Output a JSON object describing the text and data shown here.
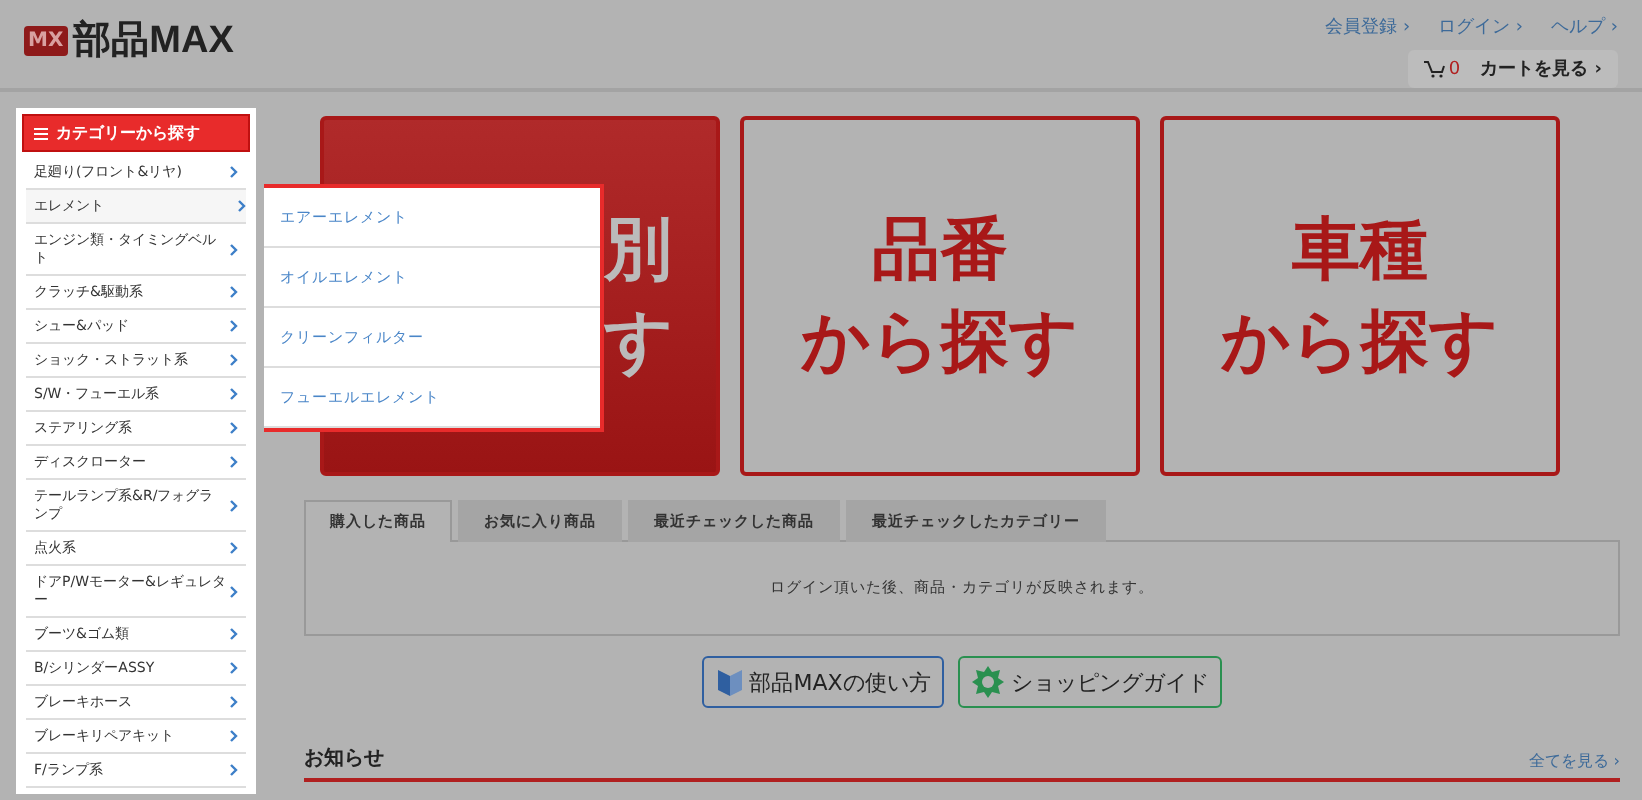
{
  "header": {
    "logo_mark": "MX",
    "logo_text": "部品MAX",
    "links": [
      "会員登録 ›",
      "ログイン ›",
      "ヘルプ ›"
    ],
    "cart_count": "0",
    "cart_button": "カートを見る ›"
  },
  "sidebar": {
    "title": "カテゴリーから探す",
    "items": [
      {
        "label": "足廻り(フロント&リヤ)",
        "selected": false
      },
      {
        "label": "エレメント",
        "selected": true,
        "children": [
          {
            "label": "エアーエレメント"
          },
          {
            "label": "オイルエレメント"
          },
          {
            "label": "クリーンフィルター"
          },
          {
            "label": "フューエルエレメント"
          }
        ]
      },
      {
        "label": "エンジン類・タイミングベルト",
        "selected": false
      },
      {
        "label": "クラッチ&駆動系",
        "selected": false
      },
      {
        "label": "シュー&パッド",
        "selected": false
      },
      {
        "label": "ショック・ストラット系",
        "selected": false
      },
      {
        "label": "S/W・フューエル系",
        "selected": false
      },
      {
        "label": "ステアリング系",
        "selected": false
      },
      {
        "label": "ディスクローター",
        "selected": false
      },
      {
        "label": "テールランプ系&R/フォグランプ",
        "selected": false
      },
      {
        "label": "点火系",
        "selected": false
      },
      {
        "label": "ドアP/Wモーター&レギュレター",
        "selected": false
      },
      {
        "label": "ブーツ&ゴム類",
        "selected": false
      },
      {
        "label": "B/シリンダーASSY",
        "selected": false
      },
      {
        "label": "ブレーキホース",
        "selected": false
      },
      {
        "label": "ブレーキリペアキット",
        "selected": false
      },
      {
        "label": "F/ランプ系",
        "selected": false
      }
    ]
  },
  "search_cards": [
    {
      "kind": "filled",
      "lines": [
        "別",
        "す"
      ]
    },
    {
      "kind": "outline",
      "lines": [
        "品番",
        "から探す"
      ]
    },
    {
      "kind": "outline",
      "lines": [
        "車種",
        "から探す"
      ]
    }
  ],
  "history_tabs": [
    {
      "label": "購入した商品",
      "selected": true
    },
    {
      "label": "お気に入り商品",
      "selected": false
    },
    {
      "label": "最近チェックした商品",
      "selected": false
    },
    {
      "label": "最近チェックしたカテゴリー",
      "selected": false
    }
  ],
  "history_message": "ログイン頂いた後、商品・カテゴリが反映されます。",
  "guide_buttons": [
    {
      "kind": "howto",
      "label": "部品MAXの使い方"
    },
    {
      "kind": "shopping",
      "label": "ショッピングガイド"
    }
  ],
  "news": {
    "title": "お知らせ",
    "more": "全てを見る ›"
  }
}
